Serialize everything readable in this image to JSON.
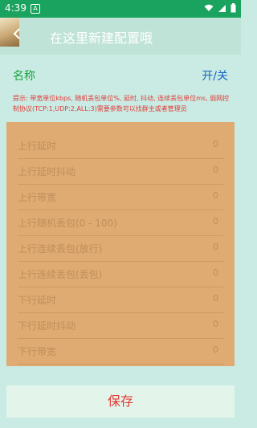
{
  "statusbar": {
    "time": "4:39",
    "notif_badge": "A"
  },
  "appbar": {
    "title": "在这里新建配置哦"
  },
  "header": {
    "name_label": "名称",
    "toggle_label": "开/关"
  },
  "hint": "提示: 带宽单位kbps, 随机丢包单位%, 延时, 抖动, 连续丢包单位ms, 弱网控制协议(TCP:1,UDP:2,ALL:3)需要参数可以找群主或者管理员",
  "fields": [
    {
      "label": "上行延时",
      "value": "0"
    },
    {
      "label": "上行延时抖动",
      "value": "0"
    },
    {
      "label": "上行带宽",
      "value": "0"
    },
    {
      "label": "上行随机丢包(0 - 100)",
      "value": "0"
    },
    {
      "label": "上行连续丢包(放行)",
      "value": "0"
    },
    {
      "label": "上行连续丢包(丢包)",
      "value": "0"
    },
    {
      "label": "下行延时",
      "value": "0"
    },
    {
      "label": "下行延时抖动",
      "value": "0"
    },
    {
      "label": "下行带宽",
      "value": "0"
    }
  ],
  "save_label": "保存",
  "colors": {
    "statusbar": "#1aa35f",
    "panel": "#dfab72",
    "accent_green": "#1aa33c",
    "accent_blue": "#1565c0",
    "accent_red": "#e53935"
  }
}
